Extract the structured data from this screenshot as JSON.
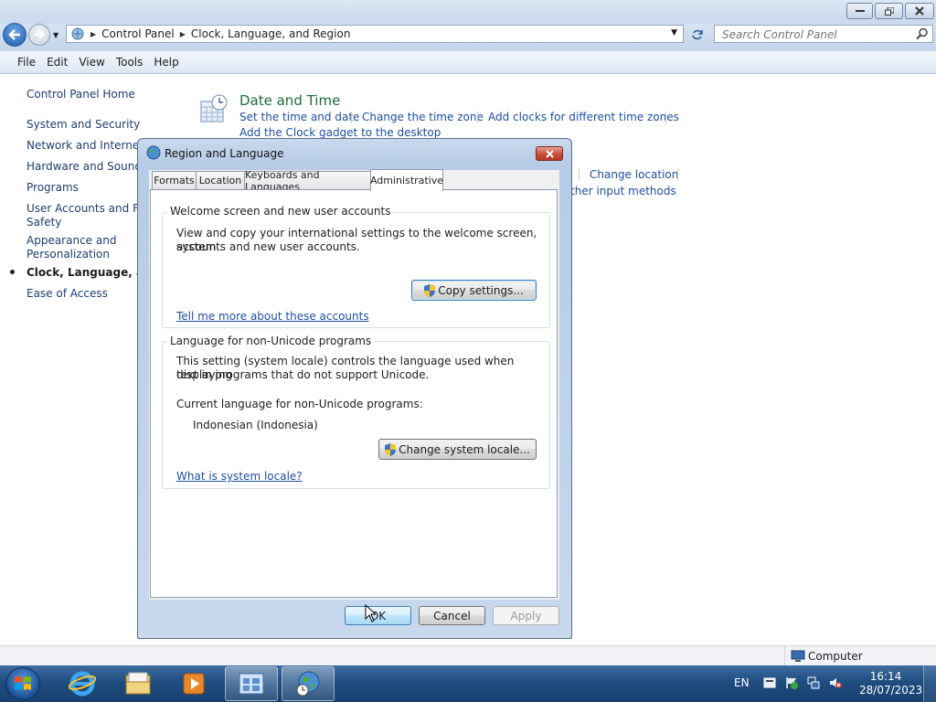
{
  "window": {
    "address": {
      "crumbs": [
        "Control Panel",
        "Clock, Language, and Region"
      ]
    },
    "search_placeholder": "Search Control Panel",
    "menu": [
      "File",
      "Edit",
      "View",
      "Tools",
      "Help"
    ]
  },
  "left_pane": {
    "home": "Control Panel Home",
    "items": [
      "System and Security",
      "Network and Internet",
      "Hardware and Sound",
      "Programs",
      "User Accounts and Fan",
      "Safety",
      "Appearance and",
      "Personalization",
      "Clock, Language, and I",
      "Ease of Access"
    ]
  },
  "main": {
    "date_time": {
      "title": "Date and Time",
      "links": [
        "Set the time and date",
        "Change the time zone",
        "Add clocks for different time zones"
      ],
      "link2": "Add the Clock gadget to the desktop"
    },
    "region": {
      "change_location": "Change location",
      "other_input": "ther input methods"
    }
  },
  "dialog": {
    "title": "Region and Language",
    "tabs": [
      "Formats",
      "Location",
      "Keyboards and Languages",
      "Administrative"
    ],
    "welcome": {
      "label": "Welcome screen and new user accounts",
      "text1": "View and copy your international settings to the welcome screen, system",
      "text2": "accounts and new user accounts.",
      "copy_button": "Copy settings...",
      "link": "Tell me more about these accounts"
    },
    "nonunicode": {
      "label": "Language for non-Unicode programs",
      "text1": "This setting (system locale) controls the language used when displaying",
      "text2": "text in programs that do not support Unicode.",
      "current_label": "Current language for non-Unicode programs:",
      "current_value": "Indonesian (Indonesia)",
      "change_button": "Change system locale...",
      "link": "What is system locale?"
    },
    "buttons": {
      "ok": "OK",
      "cancel": "Cancel",
      "apply": "Apply"
    }
  },
  "statusbar": {
    "computer": "Computer"
  },
  "taskbar": {
    "lang": "EN",
    "time": "16:14",
    "date": "28/07/2023"
  }
}
